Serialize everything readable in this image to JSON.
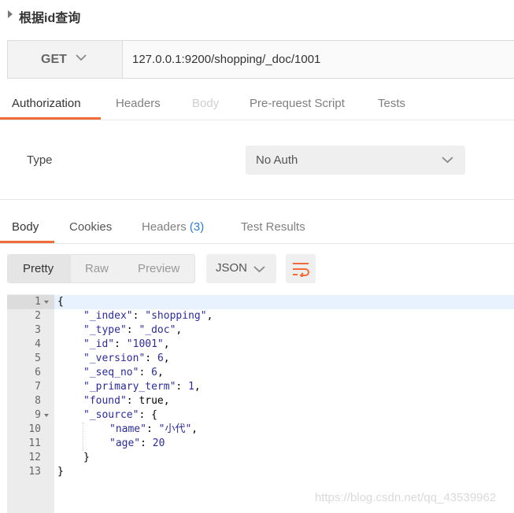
{
  "request": {
    "title": "根据id查询",
    "method": "GET",
    "url": "127.0.0.1:9200/shopping/_doc/1001"
  },
  "request_tabs": [
    "Authorization",
    "Headers",
    "Body",
    "Pre-request Script",
    "Tests"
  ],
  "auth": {
    "type_label": "Type",
    "type_value": "No Auth"
  },
  "response_tabs": {
    "body": "Body",
    "cookies": "Cookies",
    "headers": "Headers",
    "headers_count": "(3)",
    "test_results": "Test Results"
  },
  "view_modes": [
    "Pretty",
    "Raw",
    "Preview"
  ],
  "format": "JSON",
  "line_numbers": [
    "1",
    "2",
    "3",
    "4",
    "5",
    "6",
    "7",
    "8",
    "9",
    "10",
    "11",
    "12",
    "13"
  ],
  "json_lines": [
    {
      "key": "",
      "value": "{"
    },
    {
      "key": "\"_index\"",
      "value": "\"shopping\""
    },
    {
      "key": "\"_type\"",
      "value": "\"_doc\""
    },
    {
      "key": "\"_id\"",
      "value": "\"1001\""
    },
    {
      "key": "\"_version\"",
      "value": "6"
    },
    {
      "key": "\"_seq_no\"",
      "value": "6"
    },
    {
      "key": "\"_primary_term\"",
      "value": "1"
    },
    {
      "key": "\"found\"",
      "value": "true"
    },
    {
      "key": "\"_source\"",
      "value": "{"
    },
    {
      "key": "\"name\"",
      "value": "\"小代\""
    },
    {
      "key": "\"age\"",
      "value": "20"
    },
    {
      "key": "",
      "value": "}"
    },
    {
      "key": "",
      "value": "}"
    }
  ],
  "watermark": "https://blog.csdn.net/qq_43539962",
  "colors": {
    "accent": "#f26b3a",
    "link": "#2a7bd2",
    "json_token": "#2b2b9e"
  }
}
